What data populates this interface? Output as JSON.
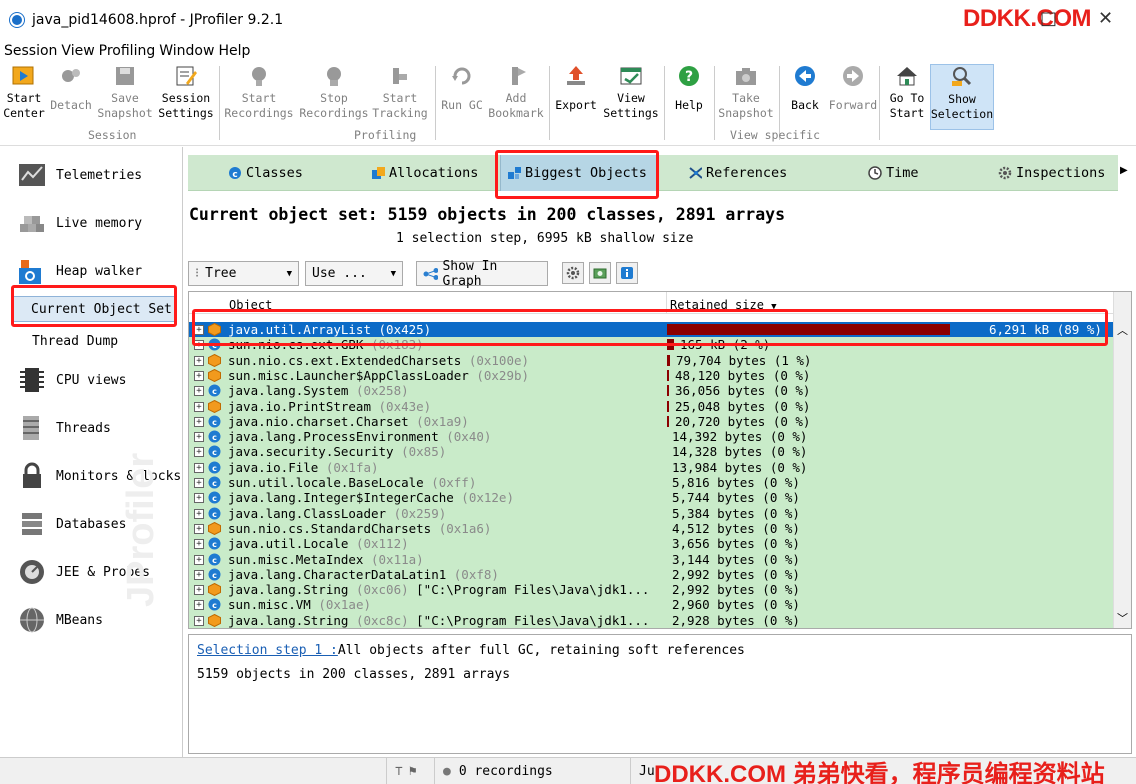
{
  "window": {
    "title": "java_pid14608.hprof - JProfiler 9.2.1",
    "watermark": "DDKK.COM",
    "minimize": "–",
    "maximize": "□",
    "close": "✕"
  },
  "menu": [
    "Session",
    "View",
    "Profiling",
    "Window",
    "Help"
  ],
  "toolbar": {
    "buttons": [
      {
        "l1": "Start",
        "l2": "Center",
        "icon": "start-center-icon",
        "enabled": true
      },
      {
        "l1": "",
        "l2": "Detach",
        "icon": "detach-icon",
        "enabled": false
      },
      {
        "l1": "Save",
        "l2": "Snapshot",
        "icon": "save-snapshot-icon",
        "enabled": false
      },
      {
        "l1": "Session",
        "l2": "Settings",
        "icon": "session-settings-icon",
        "enabled": true
      },
      {
        "l1": "Start",
        "l2": "Recordings",
        "icon": "start-recordings-icon",
        "enabled": false
      },
      {
        "l1": "Stop",
        "l2": "Recordings",
        "icon": "stop-recordings-icon",
        "enabled": false
      },
      {
        "l1": "Start",
        "l2": "Tracking",
        "icon": "start-tracking-icon",
        "enabled": false
      },
      {
        "l1": "",
        "l2": "Run GC",
        "icon": "run-gc-icon",
        "enabled": false
      },
      {
        "l1": "Add",
        "l2": "Bookmark",
        "icon": "add-bookmark-icon",
        "enabled": false
      },
      {
        "l1": "",
        "l2": "Export",
        "icon": "export-icon",
        "enabled": true
      },
      {
        "l1": "View",
        "l2": "Settings",
        "icon": "view-settings-icon",
        "enabled": true
      },
      {
        "l1": "",
        "l2": "Help",
        "icon": "help-icon",
        "enabled": true
      },
      {
        "l1": "Take",
        "l2": "Snapshot",
        "icon": "take-snapshot-icon",
        "enabled": false
      },
      {
        "l1": "",
        "l2": "Back",
        "icon": "back-icon",
        "enabled": true
      },
      {
        "l1": "",
        "l2": "Forward",
        "icon": "forward-icon",
        "enabled": false
      },
      {
        "l1": "Go To",
        "l2": "Start",
        "icon": "go-to-start-icon",
        "enabled": true
      },
      {
        "l1": "Show",
        "l2": "Selection",
        "icon": "show-selection-icon",
        "enabled": true,
        "active": true
      }
    ],
    "groups": {
      "session": "Session",
      "profiling": "Profiling",
      "view_specific": "View specific"
    }
  },
  "sidebar": {
    "items": [
      {
        "label": "Telemetries",
        "icon": "telemetries-icon"
      },
      {
        "label": "Live memory",
        "icon": "live-memory-icon"
      },
      {
        "label": "Heap walker",
        "icon": "heap-walker-icon"
      },
      {
        "label": "CPU views",
        "icon": "cpu-views-icon"
      },
      {
        "label": "Threads",
        "icon": "threads-icon"
      },
      {
        "label": "Monitors & locks",
        "icon": "monitors-locks-icon"
      },
      {
        "label": "Databases",
        "icon": "databases-icon"
      },
      {
        "label": "JEE & Probes",
        "icon": "jee-probes-icon"
      },
      {
        "label": "MBeans",
        "icon": "mbeans-icon"
      }
    ],
    "sub_items": [
      {
        "label": "Current Object Set",
        "selected": true
      },
      {
        "label": "Thread Dump",
        "selected": false
      }
    ],
    "brand": "JProfiler"
  },
  "view_tabs": [
    {
      "label": "Classes",
      "icon": "classes-icon"
    },
    {
      "label": "Allocations",
      "icon": "allocations-icon"
    },
    {
      "label": "Biggest Objects",
      "icon": "biggest-objects-icon",
      "active": true
    },
    {
      "label": "References",
      "icon": "references-icon"
    },
    {
      "label": "Time",
      "icon": "time-icon"
    },
    {
      "label": "Inspections",
      "icon": "inspections-icon"
    }
  ],
  "heading": "Current object set: 5159 objects in 200 classes, 2891 arrays",
  "subheading": "1 selection step, 6995 kB shallow size",
  "viewbar": {
    "mode": "Tree",
    "use": "Use ...",
    "show_graph": "Show In Graph"
  },
  "table": {
    "columns": [
      "Object",
      "Retained size"
    ],
    "rows": [
      {
        "name": "java.util.ArrayList",
        "addr": "(0x425)",
        "size": "6,291 kB (89 %)",
        "pct": 89,
        "kind": "object",
        "selected": true
      },
      {
        "name": "sun.nio.cs.ext.GBK",
        "addr": "(0x183)",
        "size": "165 kB (2 %)",
        "pct": 2.3,
        "kind": "class",
        "selected": false
      },
      {
        "name": "sun.nio.cs.ext.ExtendedCharsets",
        "addr": "(0x100e)",
        "size": "79,704 bytes (1 %)",
        "pct": 1.1,
        "kind": "object",
        "selected": false
      },
      {
        "name": "sun.misc.Launcher$AppClassLoader",
        "addr": "(0x29b)",
        "size": "48,120 bytes (0 %)",
        "pct": 0.7,
        "kind": "object",
        "selected": false
      },
      {
        "name": "java.lang.System",
        "addr": "(0x258)",
        "size": "36,056 bytes (0 %)",
        "pct": 0.5,
        "kind": "class",
        "selected": false
      },
      {
        "name": "java.io.PrintStream",
        "addr": "(0x43e)",
        "size": "25,048 bytes (0 %)",
        "pct": 0.35,
        "kind": "object",
        "selected": false
      },
      {
        "name": "java.nio.charset.Charset",
        "addr": "(0x1a9)",
        "size": "20,720 bytes (0 %)",
        "pct": 0.3,
        "kind": "class",
        "selected": false
      },
      {
        "name": "java.lang.ProcessEnvironment",
        "addr": "(0x40)",
        "size": "14,392 bytes (0 %)",
        "pct": 0,
        "kind": "class",
        "selected": false
      },
      {
        "name": "java.security.Security",
        "addr": "(0x85)",
        "size": "14,328 bytes (0 %)",
        "pct": 0,
        "kind": "class",
        "selected": false
      },
      {
        "name": "java.io.File",
        "addr": "(0x1fa)",
        "size": "13,984 bytes (0 %)",
        "pct": 0,
        "kind": "class",
        "selected": false
      },
      {
        "name": "sun.util.locale.BaseLocale",
        "addr": "(0xff)",
        "size": "5,816 bytes (0 %)",
        "pct": 0,
        "kind": "class",
        "selected": false
      },
      {
        "name": "java.lang.Integer$IntegerCache",
        "addr": "(0x12e)",
        "size": "5,744 bytes (0 %)",
        "pct": 0,
        "kind": "class",
        "selected": false
      },
      {
        "name": "java.lang.ClassLoader",
        "addr": "(0x259)",
        "size": "5,384 bytes (0 %)",
        "pct": 0,
        "kind": "class",
        "selected": false
      },
      {
        "name": "sun.nio.cs.StandardCharsets",
        "addr": "(0x1a6)",
        "size": "4,512 bytes (0 %)",
        "pct": 0,
        "kind": "object",
        "selected": false
      },
      {
        "name": "java.util.Locale",
        "addr": "(0x112)",
        "size": "3,656 bytes (0 %)",
        "pct": 0,
        "kind": "class",
        "selected": false
      },
      {
        "name": "sun.misc.MetaIndex",
        "addr": "(0x11a)",
        "size": "3,144 bytes (0 %)",
        "pct": 0,
        "kind": "class",
        "selected": false
      },
      {
        "name": "java.lang.CharacterDataLatin1",
        "addr": "(0xf8)",
        "size": "2,992 bytes (0 %)",
        "pct": 0,
        "kind": "class",
        "selected": false
      },
      {
        "name": "java.lang.String",
        "addr": "(0xc06)",
        "extra": "[\"C:\\Program Files\\Java\\jdk1...",
        "size": "2,992 bytes (0 %)",
        "pct": 0,
        "kind": "object",
        "selected": false
      },
      {
        "name": "sun.misc.VM",
        "addr": "(0x1ae)",
        "size": "2,960 bytes (0 %)",
        "pct": 0,
        "kind": "class",
        "selected": false
      },
      {
        "name": "java.lang.String",
        "addr": "(0xc8c)",
        "extra": "[\"C:\\Program Files\\Java\\jdk1...",
        "size": "2,928 bytes (0 %)",
        "pct": 0,
        "kind": "object",
        "selected": false
      }
    ]
  },
  "selection_steps": {
    "step_link": "Selection step 1 :",
    "step_desc": "All objects after full GC, retaining soft references",
    "summary": "5159 objects in 200 classes, 2891 arrays"
  },
  "statusbar": {
    "recordings": "0 recordings",
    "time_prefix": "Ju",
    "footer_watermark": "DDKK.COM 弟弟快看，程序员编程资料站"
  },
  "colors": {
    "accent": "#0c6bc7",
    "tabs_bg": "#cfe8cf",
    "rows_bg": "#c9ebc9",
    "bar": "#8b0000",
    "highlight": "#ff1a1a"
  }
}
